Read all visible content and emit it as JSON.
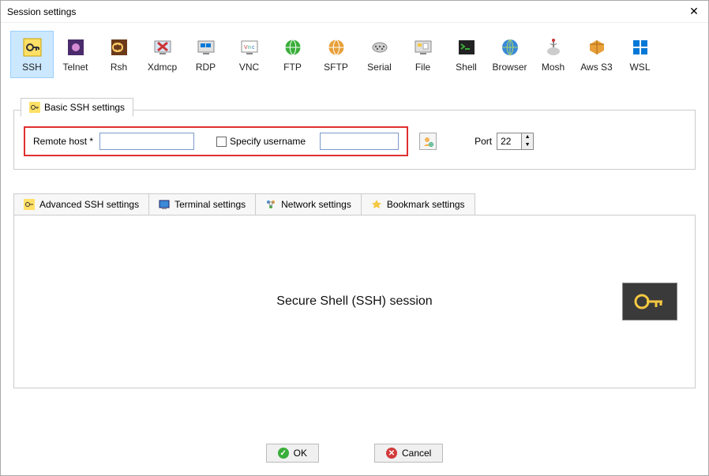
{
  "window": {
    "title": "Session settings"
  },
  "protocols": [
    {
      "id": "ssh",
      "label": "SSH"
    },
    {
      "id": "telnet",
      "label": "Telnet"
    },
    {
      "id": "rsh",
      "label": "Rsh"
    },
    {
      "id": "xdmcp",
      "label": "Xdmcp"
    },
    {
      "id": "rdp",
      "label": "RDP"
    },
    {
      "id": "vnc",
      "label": "VNC"
    },
    {
      "id": "ftp",
      "label": "FTP"
    },
    {
      "id": "sftp",
      "label": "SFTP"
    },
    {
      "id": "serial",
      "label": "Serial"
    },
    {
      "id": "file",
      "label": "File"
    },
    {
      "id": "shell",
      "label": "Shell"
    },
    {
      "id": "browser",
      "label": "Browser"
    },
    {
      "id": "mosh",
      "label": "Mosh"
    },
    {
      "id": "awss3",
      "label": "Aws S3"
    },
    {
      "id": "wsl",
      "label": "WSL"
    }
  ],
  "selected_protocol": "ssh",
  "basic_tab": {
    "label": "Basic SSH settings"
  },
  "basic": {
    "remote_host_label": "Remote host *",
    "remote_host_value": "",
    "specify_username_label": "Specify username",
    "specify_username_checked": false,
    "username_value": "",
    "port_label": "Port",
    "port_value": "22"
  },
  "adv_tabs": {
    "advanced": "Advanced SSH settings",
    "terminal": "Terminal settings",
    "network": "Network settings",
    "bookmark": "Bookmark settings"
  },
  "session_desc": "Secure Shell (SSH) session",
  "buttons": {
    "ok": "OK",
    "cancel": "Cancel"
  }
}
